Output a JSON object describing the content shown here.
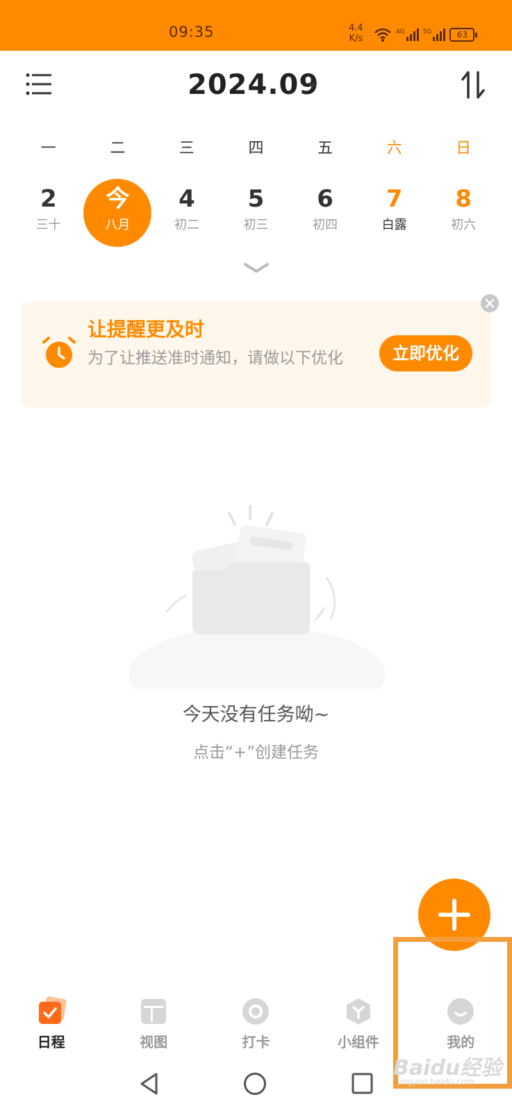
{
  "status_bar": {
    "time": "09:35",
    "net_speed_value": "4.4",
    "net_speed_unit": "K/s",
    "signal_1": "4G",
    "signal_2": "5G",
    "battery": "63"
  },
  "header": {
    "menu_icon": "menu-list-icon",
    "title": "2024.09",
    "caret_icon": "caret-down-icon",
    "sort_icon": "sort-arrows-icon"
  },
  "week": {
    "weekdays": [
      "一",
      "二",
      "三",
      "四",
      "五",
      "六",
      "日"
    ],
    "dates": [
      {
        "num": "2",
        "lunar": "三十"
      },
      {
        "num": "今",
        "lunar": "八月"
      },
      {
        "num": "4",
        "lunar": "初二"
      },
      {
        "num": "5",
        "lunar": "初三"
      },
      {
        "num": "6",
        "lunar": "初四"
      },
      {
        "num": "7",
        "lunar": "白露"
      },
      {
        "num": "8",
        "lunar": "初六"
      }
    ],
    "expand_icon": "chevron-down-icon"
  },
  "banner": {
    "title": "让提醒更及时",
    "text": "为了让推送准时通知，请做以下优化",
    "button": "立即优化",
    "icon": "alarm-clock-icon",
    "close_icon": "close-icon"
  },
  "empty_state": {
    "title": "今天没有任务呦~",
    "hint": "点击“+”创建任务",
    "illustration": "empty-folder-illustration"
  },
  "fab": {
    "icon": "plus-icon"
  },
  "tabs": [
    {
      "label": "日程",
      "icon": "calendar-check-icon",
      "active": true
    },
    {
      "label": "视图",
      "icon": "layout-icon",
      "active": false
    },
    {
      "label": "打卡",
      "icon": "checkin-icon",
      "active": false
    },
    {
      "label": "小组件",
      "icon": "widget-icon",
      "active": false
    },
    {
      "label": "我的",
      "icon": "profile-icon",
      "active": false
    }
  ],
  "nav": {
    "back": "back-triangle-icon",
    "home": "home-circle-icon",
    "recent": "recent-square-icon"
  },
  "watermark": {
    "brand": "Baidu经验",
    "sub": "jingyan.baidu.com"
  },
  "colors": {
    "accent": "#FF8A00",
    "banner_bg": "#FFF7EC",
    "highlight": "#F29E3C"
  }
}
